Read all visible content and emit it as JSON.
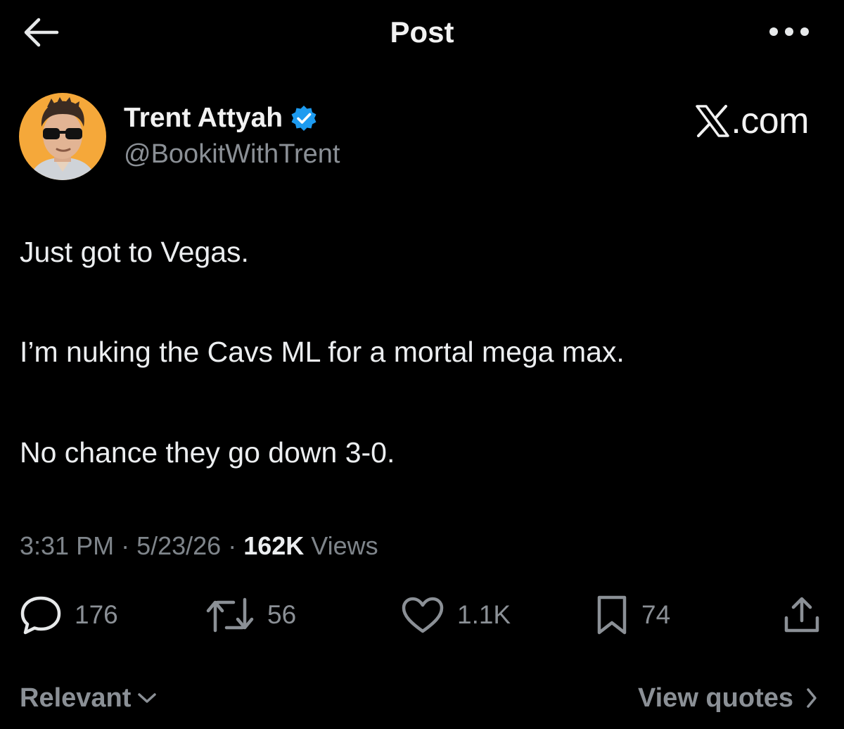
{
  "header": {
    "title": "Post",
    "back_icon": "arrow-left-icon",
    "more_icon": "more-horizontal-icon"
  },
  "author": {
    "name": "Trent Attyah",
    "handle": "@BookitWithTrent",
    "verified_icon": "verified-badge-icon",
    "verified_color": "#1d9bf0",
    "avatar_bg": "#f5a83a"
  },
  "brand": {
    "logo_icon": "x-logo-icon",
    "suffix": ".com"
  },
  "tweet": {
    "lines": [
      "Just got to Vegas.",
      "I’m nuking the Cavs ML for a mortal mega max.",
      "No chance they go down 3-0."
    ]
  },
  "meta": {
    "time": "3:31 PM",
    "sep1": " · ",
    "date": "5/23/26",
    "sep2": " · ",
    "views_count": "162K",
    "views_label": " Views"
  },
  "actions": {
    "replies": "176",
    "reposts": "56",
    "likes": "1.1K",
    "bookmarks": "74",
    "reply_icon": "reply-icon",
    "repost_icon": "repost-icon",
    "like_icon": "heart-icon",
    "bookmark_icon": "bookmark-icon",
    "share_icon": "share-icon"
  },
  "footer": {
    "sort_label": "Relevant",
    "quotes_label": "View quotes"
  },
  "colors": {
    "background": "#000000",
    "text": "#e7e9ea",
    "muted": "#8b9096"
  }
}
